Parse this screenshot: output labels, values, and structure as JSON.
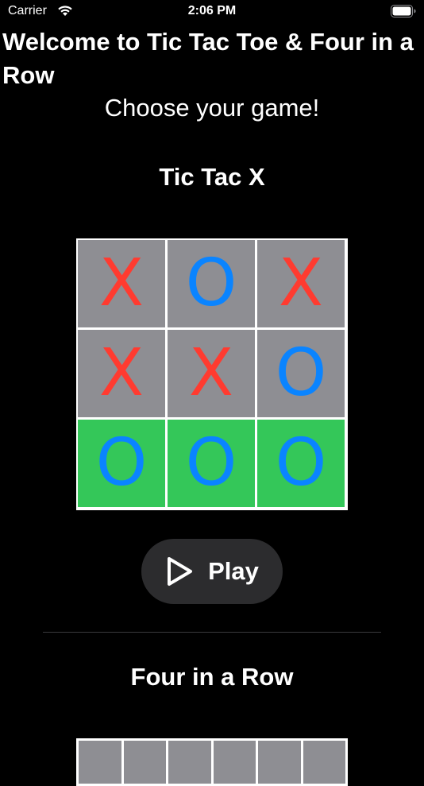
{
  "status_bar": {
    "carrier": "Carrier",
    "time": "2:06 PM"
  },
  "header": {
    "title": "Welcome to Tic Tac Toe & Four in a Row",
    "subtitle": "Choose your game!"
  },
  "tic_tac": {
    "title": "Tic Tac X",
    "board": [
      {
        "mark": "X",
        "color": "#ff3b30",
        "bg": "#8e8e93"
      },
      {
        "mark": "O",
        "color": "#0a84ff",
        "bg": "#8e8e93"
      },
      {
        "mark": "X",
        "color": "#ff3b30",
        "bg": "#8e8e93"
      },
      {
        "mark": "X",
        "color": "#ff3b30",
        "bg": "#8e8e93"
      },
      {
        "mark": "X",
        "color": "#ff3b30",
        "bg": "#8e8e93"
      },
      {
        "mark": "O",
        "color": "#0a84ff",
        "bg": "#8e8e93"
      },
      {
        "mark": "O",
        "color": "#0a84ff",
        "bg": "#34c759"
      },
      {
        "mark": "O",
        "color": "#0a84ff",
        "bg": "#34c759"
      },
      {
        "mark": "O",
        "color": "#0a84ff",
        "bg": "#34c759"
      }
    ],
    "play_label": "Play"
  },
  "four_in_a_row": {
    "title": "Four in a Row",
    "visible_columns": 6
  },
  "colors": {
    "background": "#000000",
    "x_mark": "#ff3b30",
    "o_mark": "#0a84ff",
    "cell_default": "#8e8e93",
    "cell_win": "#34c759",
    "button_bg": "#2c2c2e"
  },
  "icons": {
    "wifi": "wifi-icon",
    "battery": "battery-icon",
    "play": "play-icon"
  }
}
